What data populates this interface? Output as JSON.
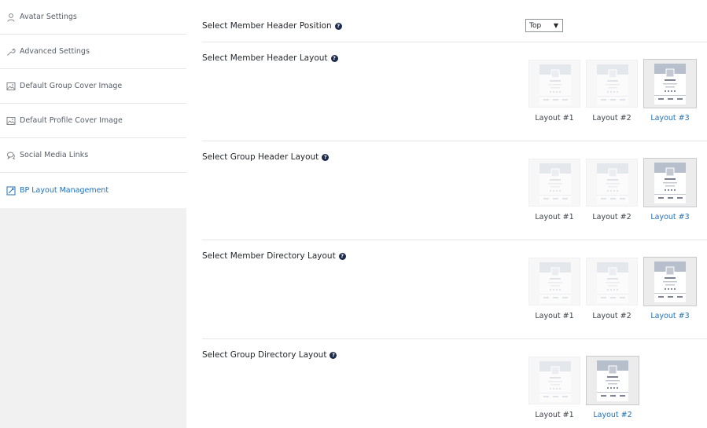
{
  "sidebar": {
    "items": [
      {
        "label": "Avatar Settings",
        "icon": "user-icon",
        "active": false
      },
      {
        "label": "Advanced Settings",
        "icon": "wrench-icon",
        "active": false
      },
      {
        "label": "Default Group Cover Image",
        "icon": "image-icon",
        "active": false
      },
      {
        "label": "Default Profile Cover Image",
        "icon": "image-icon",
        "active": false
      },
      {
        "label": "Social Media Links",
        "icon": "chat-bubble-icon",
        "active": false
      },
      {
        "label": "BP Layout Management",
        "icon": "layout-edit-icon",
        "active": true
      }
    ]
  },
  "settings": {
    "member_header_position": {
      "label": "Select Member Header Position",
      "value": "Top"
    },
    "member_header_layout": {
      "label": "Select Member Header Layout",
      "options": [
        "Layout #1",
        "Layout #2",
        "Layout #3"
      ],
      "selected": "Layout #3"
    },
    "group_header_layout": {
      "label": "Select Group Header Layout",
      "options": [
        "Layout #1",
        "Layout #2",
        "Layout #3"
      ],
      "selected": "Layout #3"
    },
    "member_directory_layout": {
      "label": "Select Member Directory Layout",
      "options": [
        "Layout #1",
        "Layout #2",
        "Layout #3"
      ],
      "selected": "Layout #3"
    },
    "group_directory_layout": {
      "label": "Select Group Directory Layout",
      "options": [
        "Layout #1",
        "Layout #2"
      ],
      "selected": "Layout #2"
    }
  },
  "help_glyph": "?",
  "colors": {
    "accent": "#2271b1",
    "help_badge": "#1d2c4c",
    "sidebar_bg": "#f1f1f1"
  }
}
